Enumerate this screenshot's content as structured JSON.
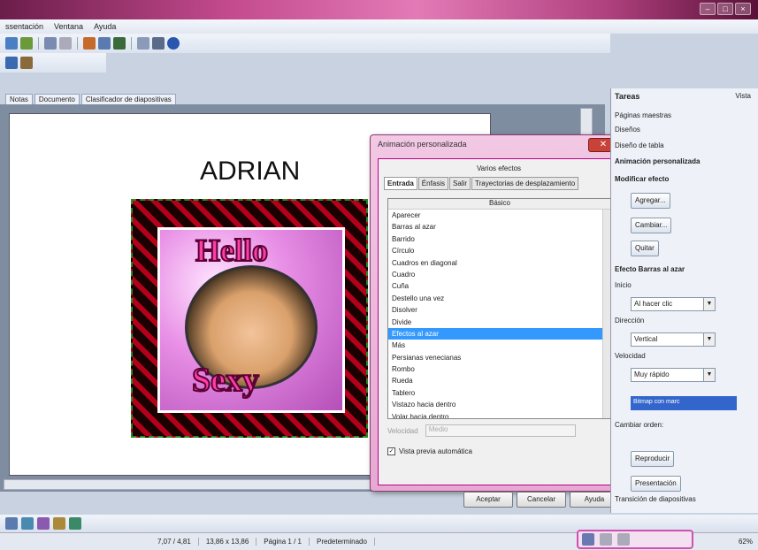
{
  "menubar": {
    "items": [
      "ssentación",
      "Ventana",
      "Ayuda"
    ]
  },
  "doc_tabs": [
    "Notas",
    "Documento",
    "Clasificador de diapositivas"
  ],
  "slide": {
    "title": "ADRIAN",
    "image_text_top": "Hello",
    "image_text_bottom": "Sexy"
  },
  "dialog": {
    "title": "Animación personalizada",
    "group_label": "Varios efectos",
    "tabs": [
      "Entrada",
      "Énfasis",
      "Salir",
      "Trayectorias de desplazamiento"
    ],
    "category": "Básico",
    "effects": [
      "Aparecer",
      "Barras al azar",
      "Barrido",
      "Círculo",
      "Cuadros en diagonal",
      "Cuadro",
      "Cuña",
      "Destello una vez",
      "Disolver",
      "Divide",
      "Efectos al azar",
      "Más",
      "Persianas venecianas",
      "Rombo",
      "Rueda",
      "Tablero",
      "Vistazo hacia dentro",
      "Volar hacia dentro"
    ],
    "selected_index": 10,
    "speed_label": "Velocidad",
    "speed_value": "Medio",
    "preview_label": "Vista previa automática",
    "buttons": {
      "ok": "Aceptar",
      "cancel": "Cancelar",
      "help": "Ayuda"
    }
  },
  "taskpane": {
    "title": "Tareas",
    "view": "Vista",
    "sections": [
      "Páginas maestras",
      "Diseños",
      "Diseño de tabla",
      "Animación personalizada"
    ],
    "modify_label": "Modificar efecto",
    "add": "Agregar...",
    "change": "Cambiar...",
    "remove": "Quitar",
    "effect_label": "Efecto Barras al azar",
    "start_label": "Inicio",
    "start_value": "Al hacer clic",
    "direction_label": "Dirección",
    "direction_value": "Vertical",
    "speed_label": "Velocidad",
    "speed_value": "Muy rápido",
    "effect_item": "Bitmap con marc",
    "reorder_label": "Cambiar orden:",
    "play": "Reproducir",
    "present": "Presentación",
    "transition": "Transición de diapositivas"
  },
  "statusbar": {
    "position": "7,07 / 4,81",
    "size": "13,86 x 13,86",
    "page": "Página 1 / 1",
    "layout": "Predeterminado",
    "zoom": "62%"
  }
}
